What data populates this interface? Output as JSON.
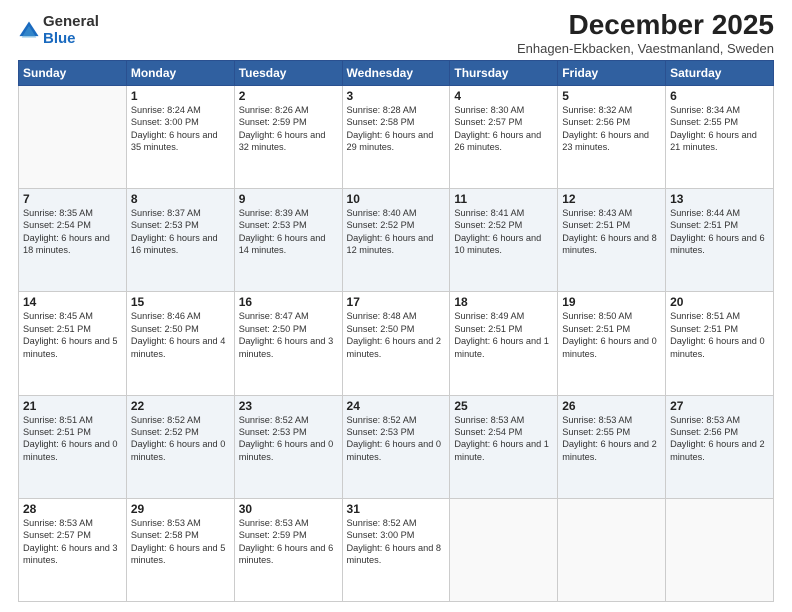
{
  "logo": {
    "general": "General",
    "blue": "Blue"
  },
  "header": {
    "month": "December 2025",
    "location": "Enhagen-Ekbacken, Vaestmanland, Sweden"
  },
  "days": [
    "Sunday",
    "Monday",
    "Tuesday",
    "Wednesday",
    "Thursday",
    "Friday",
    "Saturday"
  ],
  "weeks": [
    [
      {
        "day": "",
        "sunrise": "",
        "sunset": "",
        "daylight": ""
      },
      {
        "day": "1",
        "sunrise": "Sunrise: 8:24 AM",
        "sunset": "Sunset: 3:00 PM",
        "daylight": "Daylight: 6 hours and 35 minutes."
      },
      {
        "day": "2",
        "sunrise": "Sunrise: 8:26 AM",
        "sunset": "Sunset: 2:59 PM",
        "daylight": "Daylight: 6 hours and 32 minutes."
      },
      {
        "day": "3",
        "sunrise": "Sunrise: 8:28 AM",
        "sunset": "Sunset: 2:58 PM",
        "daylight": "Daylight: 6 hours and 29 minutes."
      },
      {
        "day": "4",
        "sunrise": "Sunrise: 8:30 AM",
        "sunset": "Sunset: 2:57 PM",
        "daylight": "Daylight: 6 hours and 26 minutes."
      },
      {
        "day": "5",
        "sunrise": "Sunrise: 8:32 AM",
        "sunset": "Sunset: 2:56 PM",
        "daylight": "Daylight: 6 hours and 23 minutes."
      },
      {
        "day": "6",
        "sunrise": "Sunrise: 8:34 AM",
        "sunset": "Sunset: 2:55 PM",
        "daylight": "Daylight: 6 hours and 21 minutes."
      }
    ],
    [
      {
        "day": "7",
        "sunrise": "Sunrise: 8:35 AM",
        "sunset": "Sunset: 2:54 PM",
        "daylight": "Daylight: 6 hours and 18 minutes."
      },
      {
        "day": "8",
        "sunrise": "Sunrise: 8:37 AM",
        "sunset": "Sunset: 2:53 PM",
        "daylight": "Daylight: 6 hours and 16 minutes."
      },
      {
        "day": "9",
        "sunrise": "Sunrise: 8:39 AM",
        "sunset": "Sunset: 2:53 PM",
        "daylight": "Daylight: 6 hours and 14 minutes."
      },
      {
        "day": "10",
        "sunrise": "Sunrise: 8:40 AM",
        "sunset": "Sunset: 2:52 PM",
        "daylight": "Daylight: 6 hours and 12 minutes."
      },
      {
        "day": "11",
        "sunrise": "Sunrise: 8:41 AM",
        "sunset": "Sunset: 2:52 PM",
        "daylight": "Daylight: 6 hours and 10 minutes."
      },
      {
        "day": "12",
        "sunrise": "Sunrise: 8:43 AM",
        "sunset": "Sunset: 2:51 PM",
        "daylight": "Daylight: 6 hours and 8 minutes."
      },
      {
        "day": "13",
        "sunrise": "Sunrise: 8:44 AM",
        "sunset": "Sunset: 2:51 PM",
        "daylight": "Daylight: 6 hours and 6 minutes."
      }
    ],
    [
      {
        "day": "14",
        "sunrise": "Sunrise: 8:45 AM",
        "sunset": "Sunset: 2:51 PM",
        "daylight": "Daylight: 6 hours and 5 minutes."
      },
      {
        "day": "15",
        "sunrise": "Sunrise: 8:46 AM",
        "sunset": "Sunset: 2:50 PM",
        "daylight": "Daylight: 6 hours and 4 minutes."
      },
      {
        "day": "16",
        "sunrise": "Sunrise: 8:47 AM",
        "sunset": "Sunset: 2:50 PM",
        "daylight": "Daylight: 6 hours and 3 minutes."
      },
      {
        "day": "17",
        "sunrise": "Sunrise: 8:48 AM",
        "sunset": "Sunset: 2:50 PM",
        "daylight": "Daylight: 6 hours and 2 minutes."
      },
      {
        "day": "18",
        "sunrise": "Sunrise: 8:49 AM",
        "sunset": "Sunset: 2:51 PM",
        "daylight": "Daylight: 6 hours and 1 minute."
      },
      {
        "day": "19",
        "sunrise": "Sunrise: 8:50 AM",
        "sunset": "Sunset: 2:51 PM",
        "daylight": "Daylight: 6 hours and 0 minutes."
      },
      {
        "day": "20",
        "sunrise": "Sunrise: 8:51 AM",
        "sunset": "Sunset: 2:51 PM",
        "daylight": "Daylight: 6 hours and 0 minutes."
      }
    ],
    [
      {
        "day": "21",
        "sunrise": "Sunrise: 8:51 AM",
        "sunset": "Sunset: 2:51 PM",
        "daylight": "Daylight: 6 hours and 0 minutes."
      },
      {
        "day": "22",
        "sunrise": "Sunrise: 8:52 AM",
        "sunset": "Sunset: 2:52 PM",
        "daylight": "Daylight: 6 hours and 0 minutes."
      },
      {
        "day": "23",
        "sunrise": "Sunrise: 8:52 AM",
        "sunset": "Sunset: 2:53 PM",
        "daylight": "Daylight: 6 hours and 0 minutes."
      },
      {
        "day": "24",
        "sunrise": "Sunrise: 8:52 AM",
        "sunset": "Sunset: 2:53 PM",
        "daylight": "Daylight: 6 hours and 0 minutes."
      },
      {
        "day": "25",
        "sunrise": "Sunrise: 8:53 AM",
        "sunset": "Sunset: 2:54 PM",
        "daylight": "Daylight: 6 hours and 1 minute."
      },
      {
        "day": "26",
        "sunrise": "Sunrise: 8:53 AM",
        "sunset": "Sunset: 2:55 PM",
        "daylight": "Daylight: 6 hours and 2 minutes."
      },
      {
        "day": "27",
        "sunrise": "Sunrise: 8:53 AM",
        "sunset": "Sunset: 2:56 PM",
        "daylight": "Daylight: 6 hours and 2 minutes."
      }
    ],
    [
      {
        "day": "28",
        "sunrise": "Sunrise: 8:53 AM",
        "sunset": "Sunset: 2:57 PM",
        "daylight": "Daylight: 6 hours and 3 minutes."
      },
      {
        "day": "29",
        "sunrise": "Sunrise: 8:53 AM",
        "sunset": "Sunset: 2:58 PM",
        "daylight": "Daylight: 6 hours and 5 minutes."
      },
      {
        "day": "30",
        "sunrise": "Sunrise: 8:53 AM",
        "sunset": "Sunset: 2:59 PM",
        "daylight": "Daylight: 6 hours and 6 minutes."
      },
      {
        "day": "31",
        "sunrise": "Sunrise: 8:52 AM",
        "sunset": "Sunset: 3:00 PM",
        "daylight": "Daylight: 6 hours and 8 minutes."
      },
      {
        "day": "",
        "sunrise": "",
        "sunset": "",
        "daylight": ""
      },
      {
        "day": "",
        "sunrise": "",
        "sunset": "",
        "daylight": ""
      },
      {
        "day": "",
        "sunrise": "",
        "sunset": "",
        "daylight": ""
      }
    ]
  ]
}
